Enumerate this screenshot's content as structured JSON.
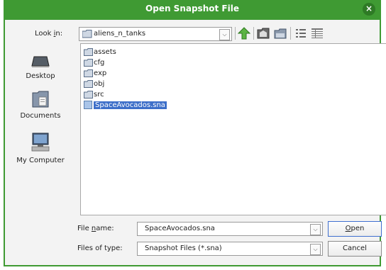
{
  "window": {
    "title": "Open Snapshot File",
    "close_glyph": "×"
  },
  "lookin": {
    "label_pre": "Look ",
    "label_u": "i",
    "label_post": "n:",
    "value": "aliens_n_tanks"
  },
  "toolbar": [
    "up-one-level-icon",
    "home-icon",
    "new-folder-icon",
    "list-view-icon",
    "details-view-icon"
  ],
  "places": [
    {
      "label": "Desktop",
      "icon": "desktop-icon"
    },
    {
      "label": "Documents",
      "icon": "documents-icon"
    },
    {
      "label": "My Computer",
      "icon": "computer-icon"
    }
  ],
  "files": [
    {
      "name": "assets",
      "type": "folder"
    },
    {
      "name": "cfg",
      "type": "folder"
    },
    {
      "name": "exp",
      "type": "folder"
    },
    {
      "name": "obj",
      "type": "folder"
    },
    {
      "name": "src",
      "type": "folder"
    },
    {
      "name": "SpaceAvocados.sna",
      "type": "file",
      "selected": true
    }
  ],
  "filename": {
    "label_pre": "File ",
    "label_u": "n",
    "label_post": "ame:",
    "value": "SpaceAvocados.sna"
  },
  "filetype": {
    "label": "Files of type:",
    "value": "Snapshot Files (*.sna)"
  },
  "buttons": {
    "open_u": "O",
    "open_rest": "pen",
    "cancel": "Cancel"
  },
  "colors": {
    "titlebar": "#3f9a33",
    "selection": "#3d6fc9"
  }
}
